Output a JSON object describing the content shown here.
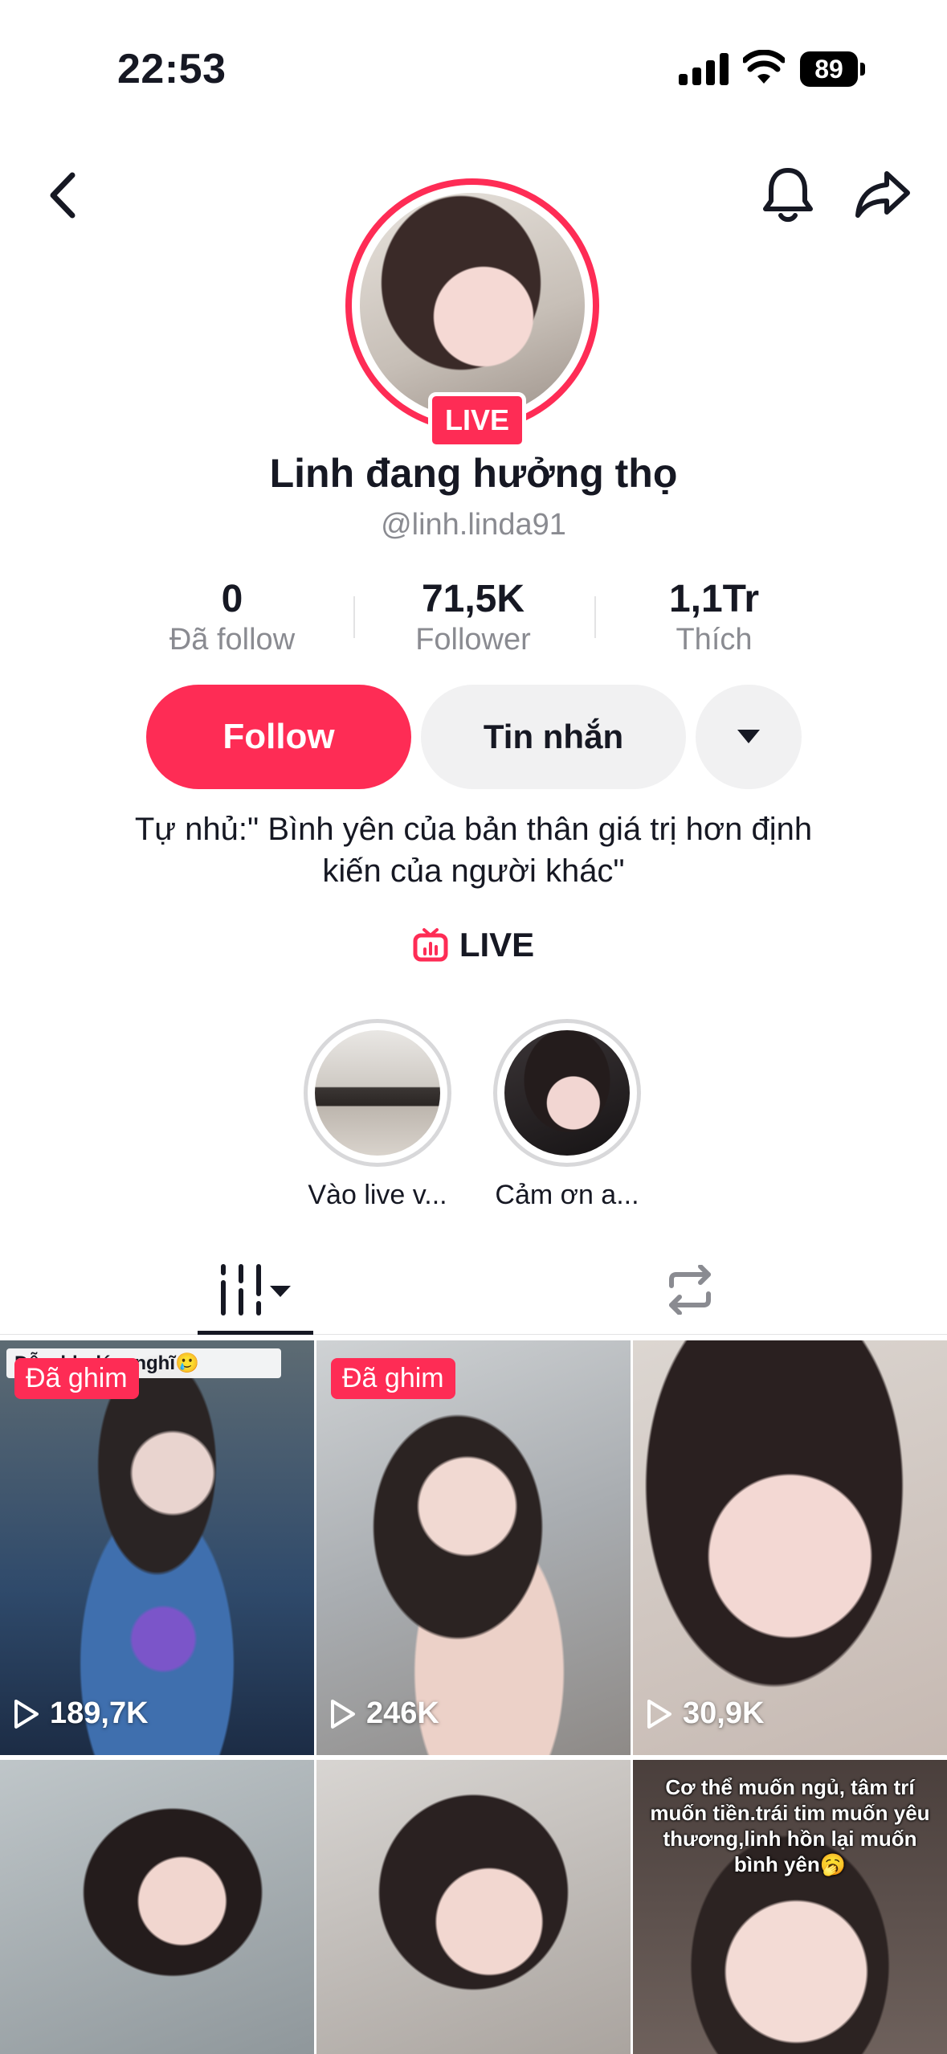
{
  "status_bar": {
    "time": "22:53",
    "battery": "89"
  },
  "profile": {
    "live_badge": "LIVE",
    "display_name": "Linh đang hưởng thọ",
    "username": "@linh.linda91",
    "stats": [
      {
        "value": "0",
        "label": "Đã follow"
      },
      {
        "value": "71,5K",
        "label": "Follower"
      },
      {
        "value": "1,1Tr",
        "label": "Thích"
      }
    ],
    "buttons": {
      "follow": "Follow",
      "message": "Tin nhắn"
    },
    "bio_line1": "Tự nhủ:\" Bình yên của bản thân giá trị hơn định",
    "bio_line2": "kiến của người khác\"",
    "live_link": "LIVE"
  },
  "highlights": [
    {
      "label": "Vào live v..."
    },
    {
      "label": "Cảm ơn a..."
    }
  ],
  "videos": [
    {
      "pinned": "Đã ghim",
      "views": "189,7K",
      "caption_top": "Dễ... bh dám nghĩ🥲"
    },
    {
      "pinned": "Đã ghim",
      "views": "246K"
    },
    {
      "views": "30,9K"
    },
    {},
    {},
    {
      "caption": "Cơ thể muốn ngủ, tâm trí muốn tiền.trái tim muốn yêu thương,linh hồn lại muốn bình yên🥱"
    }
  ],
  "colors": {
    "accent": "#fe2c55",
    "button_gray": "#f1f1f2",
    "muted_text": "#8a8b91"
  }
}
